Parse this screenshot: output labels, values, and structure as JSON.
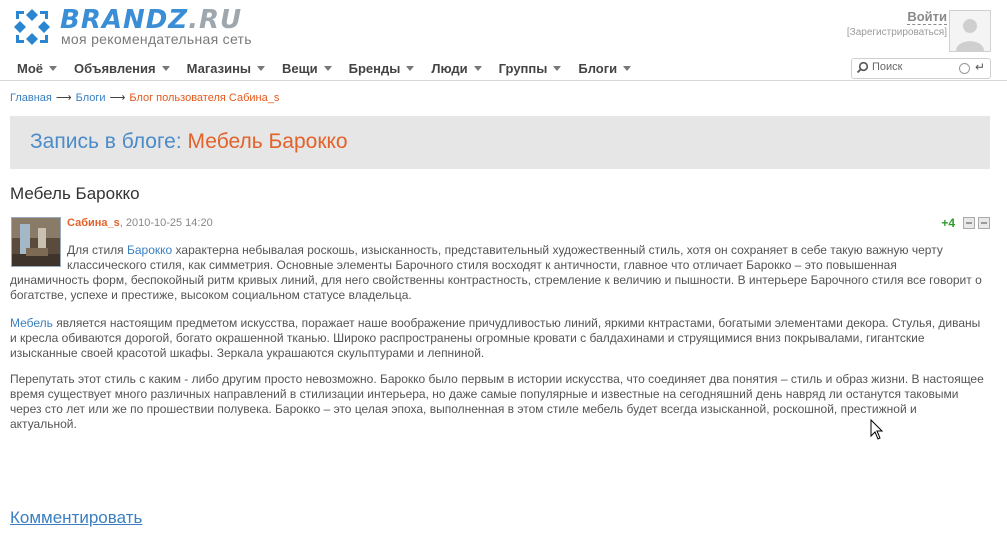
{
  "site": {
    "logo_name": "BRANDZ",
    "logo_tld": ".RU",
    "tagline": "моя рекомендательная сеть"
  },
  "account": {
    "login_label": "Войти",
    "register_label": "[Зарегистрироваться]"
  },
  "nav": {
    "items": [
      {
        "label": "Моё"
      },
      {
        "label": "Объявления"
      },
      {
        "label": "Магазины"
      },
      {
        "label": "Вещи"
      },
      {
        "label": "Бренды"
      },
      {
        "label": "Люди"
      },
      {
        "label": "Группы"
      },
      {
        "label": "Блоги"
      }
    ]
  },
  "search": {
    "placeholder": "Поиск"
  },
  "breadcrumb": {
    "home": "Главная",
    "blogs": "Блоги",
    "current": "Блог пользователя Сабина_s",
    "separator": "⟶"
  },
  "page": {
    "header_prefix": "Запись в блоге: ",
    "header_title": "Мебель Барокко",
    "post_title": "Мебель Барокко"
  },
  "post": {
    "author": "Сабина_s",
    "date": ", 2010-10-25 14:20",
    "rating": "+4",
    "p1_line1_before": "Для стиля ",
    "p1_link": "Барокко",
    "p1_line1_after": " характерна небывалая роскошь, изысканность, представительный художественный стиль, хотя он сохраняет в себе такую важную черту классического стиля, как симметрия. Основные элементы Барочного стиля восходят к античности, главное что отличает Барокко – это повышенная",
    "p1_rest": "динамичность форм, беспокойный ритм кривых линий, для него свойственны контрастность, стремление к величию и пышности. В интерьере Барочного стиля все говорит о богатстве, успехе и престиже, высоком социальном статусе владельца.",
    "p2_link": "Мебель",
    "p2_text": " является настоящим предметом искусства, поражает наше воображение причудливостью линий, яркими кнтрастами, богатыми элементами декора. Стулья, диваны и кресла обиваются дорогой, богато окрашенной тканью. Широко распространены огромные кровати с балдахинами и струящимися вниз покрывалами, гигантские изысканные своей красотой шкафы. Зеркала украшаются скульптурами и лепниной.",
    "p3_text": "Перепутать этот стиль с каким - либо другим просто невозможно. Барокко было первым в истории искусства, что соединяет два понятия – стиль и образ жизни. В настоящее время существует много различных направлений в стилизации интерьера, но даже самые популярные и известные на сегодняшний день навряд ли останутся таковыми через сто лет или же по прошествии полувека. Барокко – это целая эпоха, выполненная в этом стиле мебель будет всегда изысканной, роскошной, престижной и актуальной."
  },
  "actions": {
    "comment_label": "Комментировать"
  },
  "colors": {
    "accent_blue": "#3a7fc1",
    "accent_orange": "#e2622a",
    "rating_green": "#2e9b2e"
  }
}
